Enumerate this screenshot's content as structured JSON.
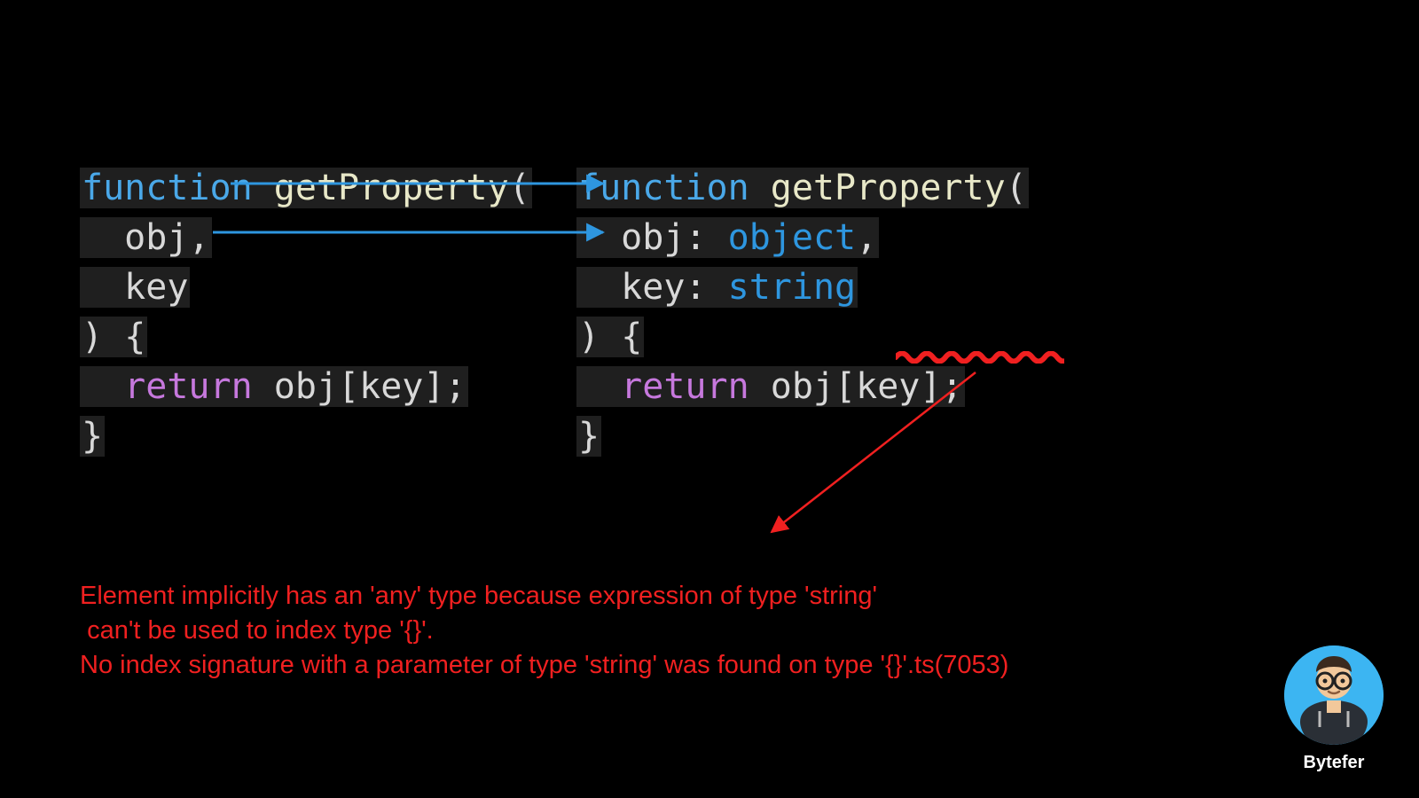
{
  "left_code": {
    "function_kw": "function",
    "fn_name": "getProperty",
    "open_paren": "(",
    "param1": "obj",
    "comma": ",",
    "param2": "key",
    "close_paren": ")",
    "brace_open": "{",
    "return_kw": "return",
    "obj_ident": "obj",
    "bracket_open": "[",
    "key_ident": "key",
    "bracket_close": "]",
    "semicolon": ";",
    "brace_close": "}"
  },
  "right_code": {
    "function_kw": "function",
    "fn_name": "getProperty",
    "open_paren": "(",
    "param1": "obj",
    "colon1": ":",
    "type1": "object",
    "comma": ",",
    "param2": "key",
    "colon2": ":",
    "type2": "string",
    "close_paren": ")",
    "brace_open": "{",
    "return_kw": "return",
    "obj_ident": "obj",
    "bracket_open": "[",
    "key_ident": "key",
    "bracket_close": "]",
    "semicolon": ";",
    "brace_close": "}"
  },
  "error": {
    "line1": "Element implicitly has an 'any' type because expression of type 'string'",
    "line2": " can't be used to index type '{}'.",
    "line3": "No index signature with a parameter of type 'string' was found on type '{}'.ts(7053)"
  },
  "author": "Bytefer"
}
